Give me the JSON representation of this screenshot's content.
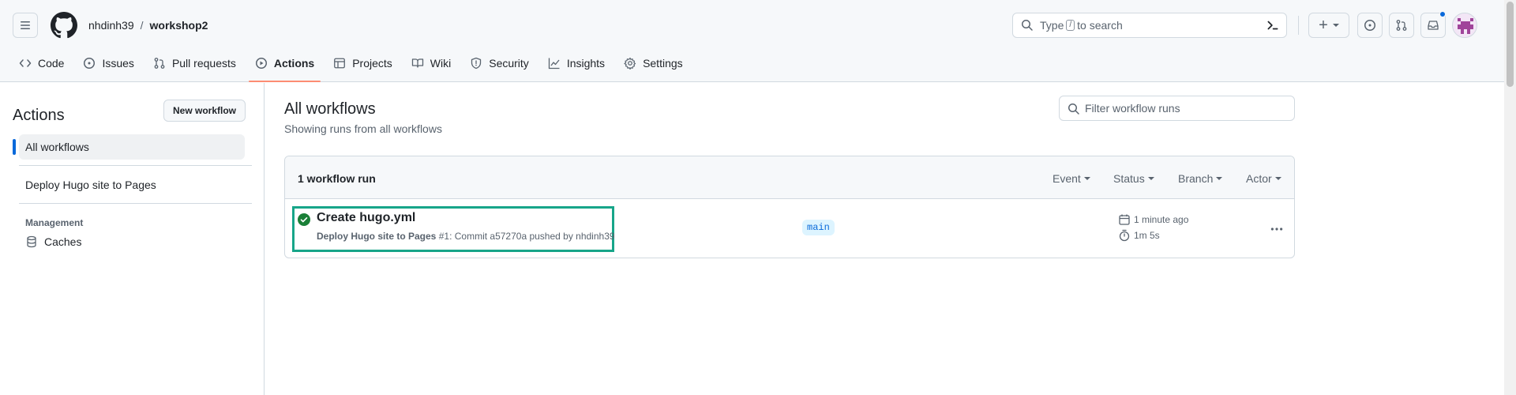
{
  "header": {
    "owner": "nhdinh39",
    "separator": "/",
    "repo": "workshop2",
    "search_prefix": "Type",
    "search_key": "/",
    "search_suffix": "to search",
    "plus_label": "+"
  },
  "repo_nav": {
    "tabs": [
      {
        "label": "Code",
        "icon": "code-icon"
      },
      {
        "label": "Issues",
        "icon": "issue-icon"
      },
      {
        "label": "Pull requests",
        "icon": "pull-request-icon"
      },
      {
        "label": "Actions",
        "icon": "play-icon",
        "active": true
      },
      {
        "label": "Projects",
        "icon": "table-icon"
      },
      {
        "label": "Wiki",
        "icon": "book-icon"
      },
      {
        "label": "Security",
        "icon": "shield-icon"
      },
      {
        "label": "Insights",
        "icon": "graph-icon"
      },
      {
        "label": "Settings",
        "icon": "gear-icon"
      }
    ]
  },
  "sidebar": {
    "title": "Actions",
    "new_workflow": "New workflow",
    "items": [
      {
        "label": "All workflows",
        "active": true
      },
      {
        "label": "Deploy Hugo site to Pages"
      }
    ],
    "management_heading": "Management",
    "caches_label": "Caches"
  },
  "main": {
    "title": "All workflows",
    "subtitle": "Showing runs from all workflows",
    "filter_placeholder": "Filter workflow runs",
    "run_count": "1 workflow run",
    "filters": [
      "Event",
      "Status",
      "Branch",
      "Actor"
    ],
    "runs": [
      {
        "title": "Create hugo.yml",
        "workflow": "Deploy Hugo site to Pages",
        "run_number": "#1",
        "commit_text": ": Commit a57270a pushed by nhdinh39",
        "branch": "main",
        "time_ago": "1 minute ago",
        "duration": "1m 5s",
        "status": "success"
      }
    ]
  },
  "colors": {
    "accent": "#0969da",
    "success": "#1a7f37",
    "highlight": "#17a589",
    "tab_underline": "#fd8c73"
  }
}
